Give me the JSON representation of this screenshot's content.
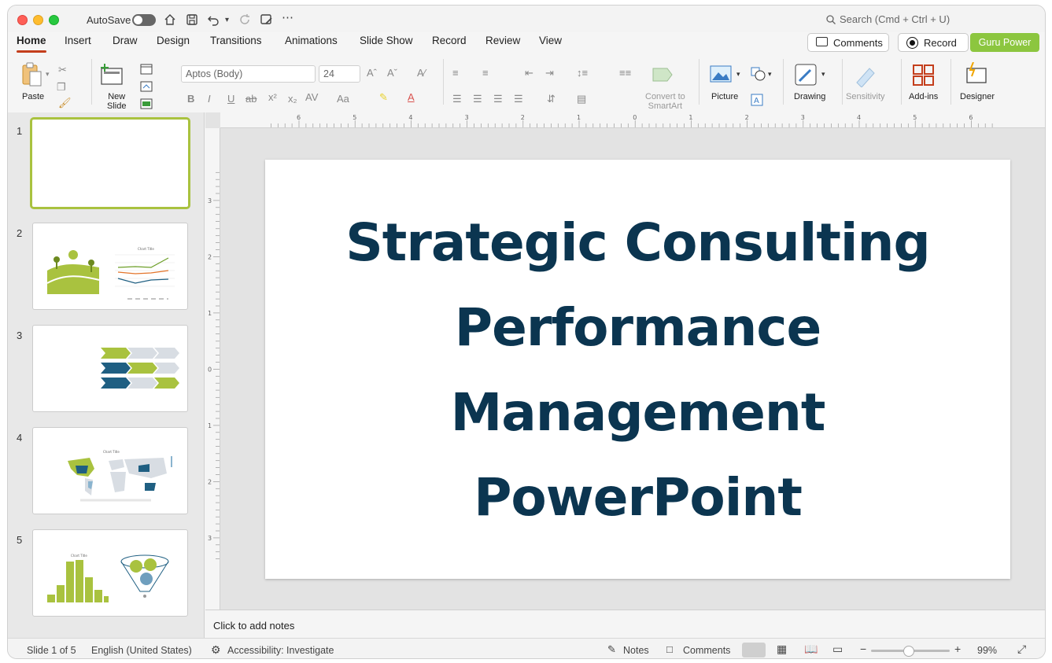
{
  "titlebar": {
    "autosave_label": "AutoSave",
    "search_placeholder": "Search (Cmd + Ctrl + U)"
  },
  "tabs": [
    "Home",
    "Insert",
    "Draw",
    "Design",
    "Transitions",
    "Animations",
    "Slide Show",
    "Record",
    "Review",
    "View"
  ],
  "active_tab": "Home",
  "header_buttons": {
    "comments": "Comments",
    "record": "Record",
    "guru": "Guru Power"
  },
  "ribbon": {
    "paste": "Paste",
    "new_slide": "New\nSlide",
    "font_name": "Aptos (Body)",
    "font_size": "24",
    "convert_smartart": "Convert to\nSmartArt",
    "picture": "Picture",
    "drawing": "Drawing",
    "sensitivity": "Sensitivity",
    "addins": "Add-ins",
    "designer": "Designer"
  },
  "ruler_top": [
    "6",
    "5",
    "4",
    "3",
    "2",
    "1",
    "0",
    "1",
    "2",
    "3",
    "4",
    "5",
    "6"
  ],
  "ruler_left": [
    "3",
    "2",
    "1",
    "0",
    "1",
    "2",
    "3"
  ],
  "slides": [
    {
      "number": "1"
    },
    {
      "number": "2"
    },
    {
      "number": "3"
    },
    {
      "number": "4"
    },
    {
      "number": "5"
    }
  ],
  "thumb_chart_title": "Chart Title",
  "slide": {
    "title_line1": "Strategic Consulting",
    "title_line2": "Performance",
    "title_line3": "Management",
    "title_line4": "PowerPoint"
  },
  "notes_placeholder": "Click to add notes",
  "status": {
    "slide_info": "Slide 1 of 5",
    "language": "English (United States)",
    "accessibility": "Accessibility: Investigate",
    "notes": "Notes",
    "comments": "Comments",
    "zoom": "99%"
  },
  "colors": {
    "accent_green": "#8cc63f",
    "title_navy": "#0b3550",
    "tab_underline": "#c43e1c",
    "thumb_blue": "#1f5f82"
  }
}
